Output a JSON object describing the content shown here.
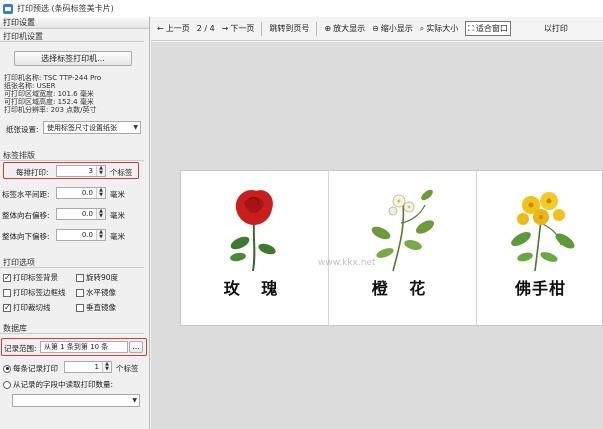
{
  "window": {
    "title": "打印预选 (条码标签美卡片)"
  },
  "left": {
    "header": "打印设置",
    "printer": {
      "section": "打印机设置",
      "select_button": "选择标签打印机...",
      "info": [
        "打印机名称: TSC TTP-244 Pro",
        "纸张名称: USER",
        "可打印区域宽度: 101.6 毫米",
        "可打印区域高度: 152.4 毫米",
        "打印机分辨率: 203 点数/英寸"
      ],
      "paper_label": "纸张设置:",
      "paper_value": "使用标签尺寸设置纸张"
    },
    "layout": {
      "section": "标签排版",
      "per_row_label": "每排打印:",
      "per_row_value": "3",
      "per_row_unit": "个标签",
      "rows": [
        {
          "label": "标签水平间距:",
          "value": "0.0",
          "unit": "毫米"
        },
        {
          "label": "整体向右偏移:",
          "value": "0.0",
          "unit": "毫米"
        },
        {
          "label": "整体向下偏移:",
          "value": "0.0",
          "unit": "毫米"
        }
      ]
    },
    "options": {
      "section": "打印选项",
      "items": [
        {
          "label": "打印标签背景",
          "checked": true
        },
        {
          "label": "旋转90度",
          "checked": false
        },
        {
          "label": "打印标签边框线",
          "checked": false
        },
        {
          "label": "水平镜像",
          "checked": false
        },
        {
          "label": "打印裁切线",
          "checked": true
        },
        {
          "label": "垂直镜像",
          "checked": false
        }
      ]
    },
    "database": {
      "section": "数据库",
      "range_label": "记录范围:",
      "range_value": "从第 1 条到第 10 条",
      "range_button": "...",
      "per_record_label": "每条记录打印",
      "per_record_value": "1",
      "per_record_unit": "个标签",
      "from_field_label": "从记录的字段中读取打印数量:",
      "from_field_value": ""
    }
  },
  "toolbar": {
    "prev": "上一页",
    "page": "2 / 4",
    "next": "下一页",
    "goto": "跳转到页号",
    "zoom_in": "放大显示",
    "zoom_out": "缩小显示",
    "actual": "实际大小",
    "fit": "适合窗口",
    "right_text": "以打印"
  },
  "preview": {
    "cards": [
      {
        "name": "玫 瑰"
      },
      {
        "name": "橙 花"
      },
      {
        "name": "佛手柑"
      }
    ],
    "watermark": "www.kkx.net"
  },
  "colors": {
    "highlight_box": "#d93a3a"
  }
}
